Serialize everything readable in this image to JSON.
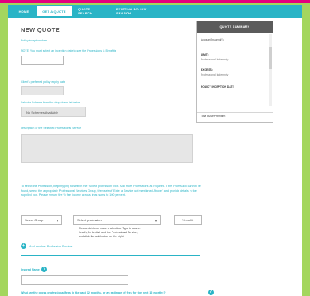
{
  "colors": {
    "page_bg": "#a4d65e",
    "accent": "#2ab4c6",
    "top_strip": "#e4007e",
    "summary_header": "#5b5b5b"
  },
  "nav": {
    "tabs": [
      {
        "label": "HOME",
        "active": false
      },
      {
        "label": "GET A QUOTE",
        "active": true
      },
      {
        "label": "QUOTE SEARCH",
        "active": false
      },
      {
        "label": "EXISTING POLICY SEARCH",
        "active": false
      }
    ]
  },
  "page": {
    "title": "NEW QUOTE",
    "policy_inception_label": "Policy inception date",
    "inception_note": "NOTE: You must select an inception date to see the Professions & Benefits",
    "preferred_policy_expiry_label": "Client's preferred policy expiry date",
    "scheme_label": "Select a Scheme from the drop down list below",
    "scheme_value": "No Schemes Available",
    "description_label": "description of the Selected Professional Service",
    "instructions": "To select the Profession, begin typing to search the \"Select profession\" box. Add more Professions as required. If the Profession cannot be found, select the appropriate Professional Services Group, then select 'Enter a Service not mentioned Above', and provide details in the supplied box. Please ensure the % fee income across lines sums to 100 percent.",
    "group_select": "Select Group",
    "profession_select": "Select profession",
    "percent_placeholder": "% outfit",
    "help_text": "Please delete or make a selection. Type to search health, fix dentist, and the Professional Service, and click the Add button on the right.",
    "add_link": "Add another Profession Service",
    "insured_name_label": "Insured Name",
    "gross_fees_label": "What are the gross professional fees in the past 12 months, or an estimate of fees for the next 12 months?"
  },
  "summary": {
    "title": "QUOTE SUMMARY",
    "rows": [
      {
        "label": "Account/Insured(s)",
        "sub": ""
      },
      {
        "label": "LIMIT:",
        "sub": "Professional Indemnity"
      },
      {
        "label": "EXCESS:",
        "sub": "Professional Indemnity"
      },
      {
        "label": "POLICY INCEPTION DATE",
        "sub": ""
      }
    ],
    "footer": "Total Base Premium"
  }
}
